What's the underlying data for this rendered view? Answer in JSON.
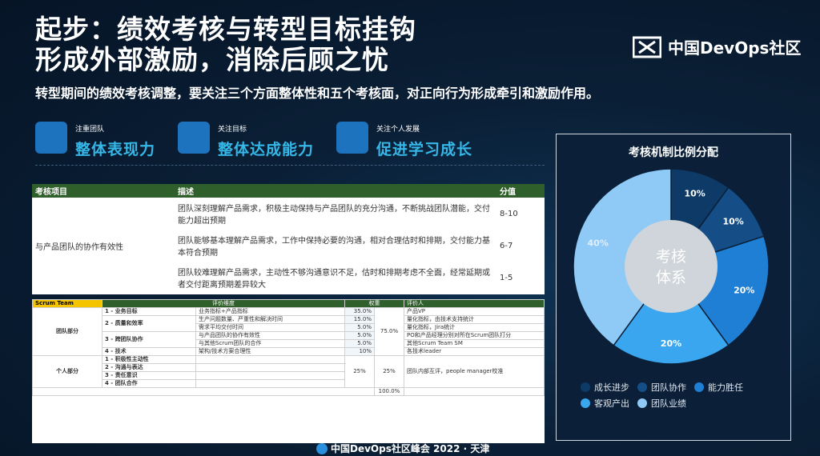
{
  "title_line1": "起步：绩效考核与转型目标挂钩",
  "title_line2": "形成外部激励，消除后顾之忧",
  "logo_text": "中国DevOps社区",
  "subtitle": "转型期间的绩效考核调整，要关注三个方面整体性和五个考核面，对正向行为形成牵引和激励作用。",
  "pillars": [
    {
      "small": "注重团队",
      "big": "整体表现力"
    },
    {
      "small": "关注目标",
      "big": "整体达成能力"
    },
    {
      "small": "关注个人发展",
      "big": "促进学习成长"
    }
  ],
  "table1": {
    "headers": [
      "考核项目",
      "描述",
      "分值"
    ],
    "item": "与产品团队的协作有效性",
    "rows": [
      {
        "desc": "团队深刻理解产品需求，积极主动保持与产品团队的充分沟通，不断挑战团队潜能，交付能力超出预期",
        "score": "8-10"
      },
      {
        "desc": "团队能够基本理解产品需求，工作中保持必要的沟通，相对合理估时和排期，交付能力基本符合预期",
        "score": "6-7"
      },
      {
        "desc": "团队较难理解产品需求，主动性不够沟通意识不足，估时和排期考虑不全面，经常延期或者交付距离预期差异较大",
        "score": "1-5"
      }
    ]
  },
  "table2": {
    "scrum_label": "Scrum Team",
    "headers": [
      "评价维度",
      "权重",
      "评价人"
    ],
    "team_label": "团队部分",
    "personal_label": "个人部分",
    "team_total": "75.0%",
    "grand_total": "100.0%",
    "team_rows": [
      {
        "cat": "1 - 业务目标",
        "metric": "业务指标+产品指标",
        "weight": "35.0%",
        "evaluator": "产品VP"
      },
      {
        "cat": "2 - 质量和效率",
        "metric": "生产问题数量、严重性和解决时间",
        "weight": "15.0%",
        "evaluator": "量化指标，由技术支持统计"
      },
      {
        "cat": "",
        "metric": "需求平均交付时间",
        "weight": "5.0%",
        "evaluator": "量化指标，Jira统计"
      },
      {
        "cat": "3 - 跨团队协作",
        "metric": "与产品团队的协作有效性",
        "weight": "5.0%",
        "evaluator": "PO和产品经理分别对所在Scrum团队打分"
      },
      {
        "cat": "",
        "metric": "与其他Scrum团队的合作",
        "weight": "5.0%",
        "evaluator": "其他Scrum Team SM"
      },
      {
        "cat": "4 - 技术",
        "metric": "架构/技术方案合理性",
        "weight": "10%",
        "evaluator": "各技术leader"
      }
    ],
    "personal_cats": [
      "1 - 积极性主动性",
      "2 - 沟通与表达",
      "3 - 责任意识",
      "4 - 团队合作"
    ],
    "personal_weight": "25%",
    "personal_total": "25%",
    "personal_evaluator": "团队内部互评，people manager校准"
  },
  "pie_card": {
    "title": "考核机制比例分配",
    "center_line1": "考核",
    "center_line2": "体系"
  },
  "chart_data": {
    "type": "pie",
    "title": "考核机制比例分配",
    "categories": [
      "成长进步",
      "团队协作",
      "能力胜任",
      "客观产出",
      "团队业绩"
    ],
    "values": [
      10,
      10,
      20,
      20,
      40
    ],
    "labels": [
      "10%",
      "10%",
      "20%",
      "20%",
      "40%"
    ],
    "colors": [
      "#0d3a66",
      "#154e86",
      "#1f7fd4",
      "#3aa6f0",
      "#8fc9f6"
    ],
    "legend_position": "bottom"
  },
  "footer": "中国DevOps社区峰会 2022 · 天津"
}
